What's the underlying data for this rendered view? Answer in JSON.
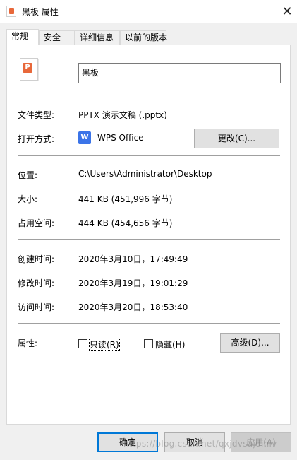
{
  "window": {
    "title": "黑板 属性",
    "close_glyph": "✕"
  },
  "tabs": [
    {
      "label": "常规",
      "active": true
    },
    {
      "label": "安全",
      "active": false
    },
    {
      "label": "详细信息",
      "active": false
    },
    {
      "label": "以前的版本",
      "active": false
    }
  ],
  "general": {
    "file_name": "黑板",
    "file_type_label": "文件类型:",
    "file_type_value": "PPTX 演示文稿 (.pptx)",
    "open_with_label": "打开方式:",
    "open_with_value": "WPS Office",
    "change_button": "更改(C)...",
    "location_label": "位置:",
    "location_value": "C:\\Users\\Administrator\\Desktop",
    "size_label": "大小:",
    "size_value": "441 KB (451,996 字节)",
    "size_on_disk_label": "占用空间:",
    "size_on_disk_value": "444 KB (454,656 字节)",
    "created_label": "创建时间:",
    "created_value": "2020年3月10日，17:49:49",
    "modified_label": "修改时间:",
    "modified_value": "2020年3月19日，19:01:29",
    "accessed_label": "访问时间:",
    "accessed_value": "2020年3月20日，18:53:40",
    "attributes_label": "属性:",
    "readonly_label": "只读(R)",
    "readonly_checked": false,
    "hidden_label": "隐藏(H)",
    "hidden_checked": false,
    "advanced_button": "高级(D)..."
  },
  "footer": {
    "ok_button": "确定",
    "cancel_button": "取消",
    "apply_button": "应用(A)",
    "watermark": "https://blog.csdn.net/qxjdvsajdihiv"
  },
  "colors": {
    "accent": "#0078d7",
    "ppt_icon": "#e8683a",
    "wps_icon": "#3b74e8"
  }
}
